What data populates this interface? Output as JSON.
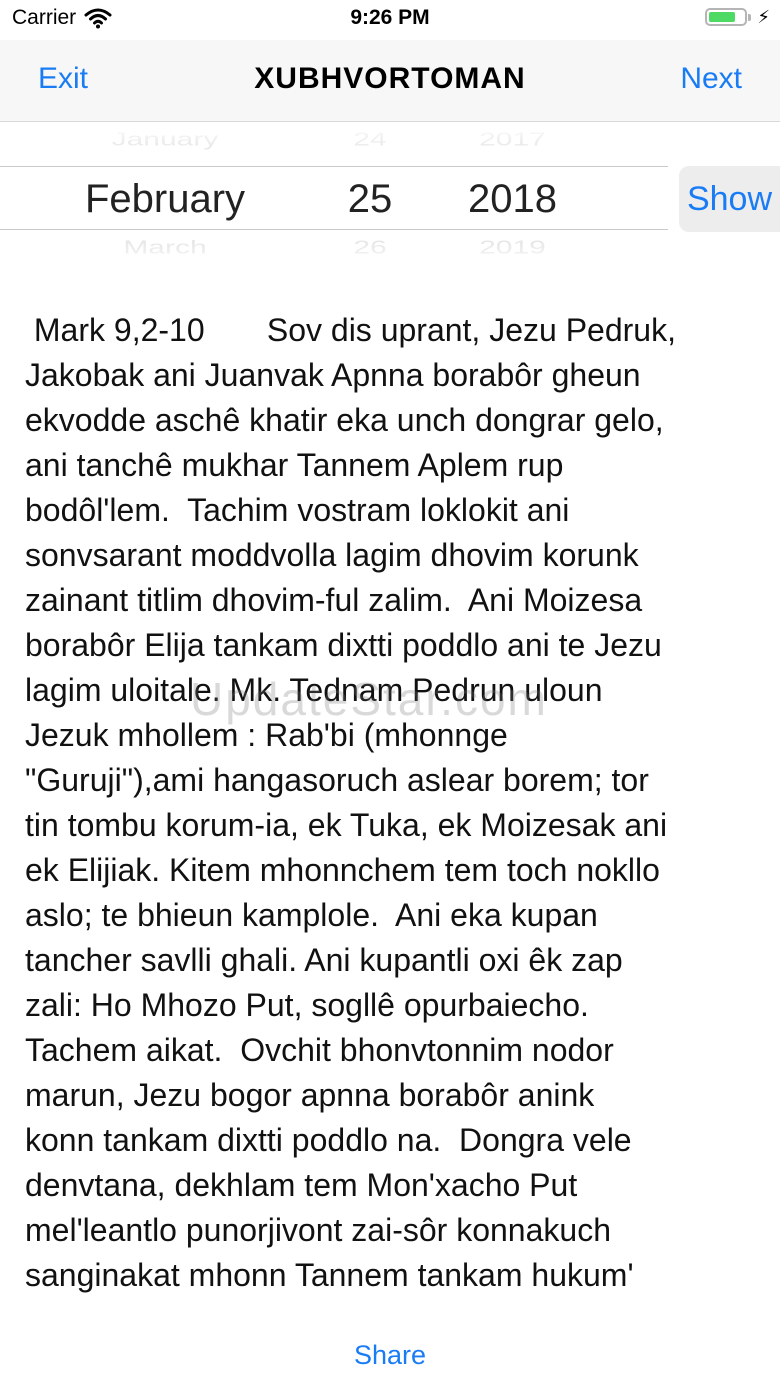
{
  "status_bar": {
    "carrier": "Carrier",
    "time": "9:26 PM",
    "battery_level": 0.75,
    "icons": [
      "wifi-icon",
      "battery-icon",
      "charging-bolt-icon"
    ]
  },
  "nav": {
    "left_label": "Exit",
    "title": "XUBHVORTOMAN",
    "right_label": "Next"
  },
  "picker": {
    "prev": {
      "month": "January",
      "day": "24",
      "year": "2017"
    },
    "selected": {
      "month": "February",
      "day": "25",
      "year": "2018"
    },
    "next": {
      "month": "March",
      "day": "26",
      "year": "2019"
    }
  },
  "show_label": "Show",
  "reading_lines": [
    " Mark 9,2-10       Sov dis uprant, Jezu Pedruk,",
    "Jakobak ani Juanvak Apnna borabôr gheun",
    "ekvodde aschê khatir eka unch dongrar gelo,",
    "ani tanchê mukhar Tannem Aplem rup",
    "bodôl'lem.  Tachim vostram loklokit ani",
    "sonvsarant moddvolla lagim dhovim korunk",
    "zainant titlim dhovim-ful zalim.  Ani Moizesa",
    "borabôr Elija tankam dixtti poddlo ani te Jezu",
    "lagim uloitale. Mk. Tednam Pedrun uloun",
    "Jezuk mhollem : Rab'bi (mhonnge",
    "\"Guruji\"),ami hangasoruch aslear borem; tor",
    "tin tombu korum-ia, ek Tuka, ek Moizesak ani",
    "ek Elijiak. Kitem mhonnchem tem toch nokllo",
    "aslo; te bhieun kamplole.  Ani eka kupan",
    "tancher savlli ghali. Ani kupantli oxi êk zap",
    "zali: Ho Mhozo Put, sogllê opurbaiecho.",
    "Tachem aikat.  Ovchit bhonvtonnim nodor",
    "marun, Jezu bogor apnna borabôr anink",
    "konn tankam dixtti poddlo na.  Dongra vele",
    "denvtana, dekhlam tem Mon'xacho Put",
    "mel'leantlo punorjivont zai-sôr konnakuch",
    "sanginakat mhonn Tannem tankam hukum'"
  ],
  "watermark": "UpdateStar.com",
  "share_label": "Share",
  "colors": {
    "accent": "#1a7cf5",
    "battery": "#4cd964"
  }
}
